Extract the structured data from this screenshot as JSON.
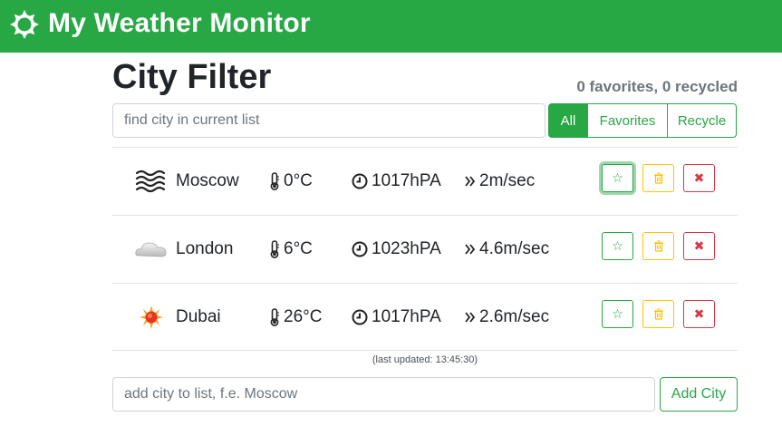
{
  "navbar": {
    "title": "My Weather Monitor",
    "icon": "sun-outline-icon"
  },
  "header": {
    "title": "City Filter",
    "counter": "0 favorites, 0 recycled"
  },
  "filter": {
    "placeholder": "find city in current list",
    "value": "",
    "options": [
      "All",
      "Favorites",
      "Recycle"
    ],
    "active": "All"
  },
  "cities": [
    {
      "name": "Moscow",
      "icon": "fog-icon",
      "temp": "0°C",
      "pressure": "1017hPA",
      "wind": "2m/sec"
    },
    {
      "name": "London",
      "icon": "cloud-icon",
      "temp": "6°C",
      "pressure": "1023hPA",
      "wind": "4.6m/sec"
    },
    {
      "name": "Dubai",
      "icon": "sun-icon",
      "temp": "26°C",
      "pressure": "1017hPA",
      "wind": "2.6m/sec"
    }
  ],
  "action_icons": {
    "favorite": "star-icon",
    "recycle": "trash-icon",
    "remove": "close-icon"
  },
  "glyphs": {
    "favorite": "☆",
    "remove": "✖"
  },
  "last_updated": "(last updated: 13:45:30)",
  "add": {
    "placeholder": "add city to list, f.e. Moscow",
    "value": "",
    "button": "Add City"
  },
  "colors": {
    "brand": "#28a745",
    "warning": "#ffc107",
    "danger": "#dc3545"
  }
}
